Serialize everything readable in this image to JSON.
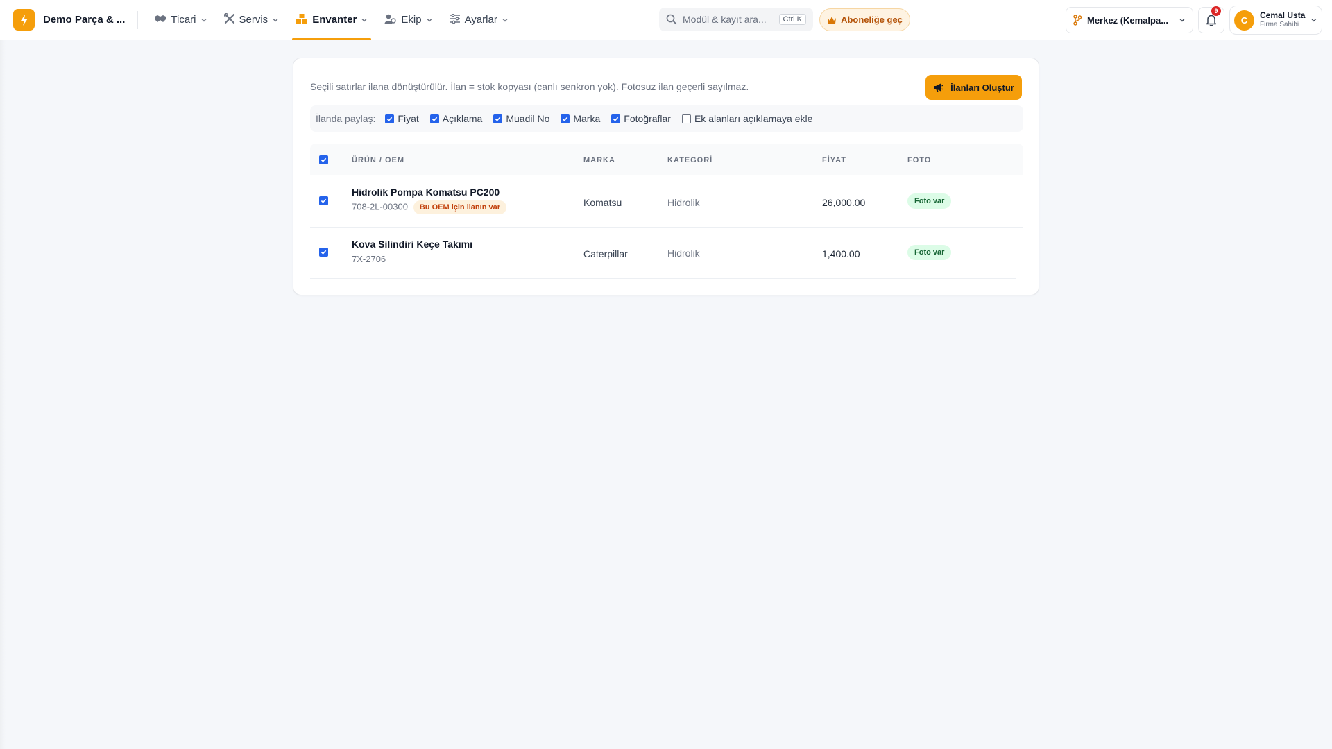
{
  "header": {
    "brand_name": "Demo Parça & ...",
    "nav": [
      {
        "label": "Ticari",
        "icon": "handshake-icon"
      },
      {
        "label": "Servis",
        "icon": "tools-icon"
      },
      {
        "label": "Envanter",
        "icon": "boxes-icon"
      },
      {
        "label": "Ekip",
        "icon": "users-icon"
      },
      {
        "label": "Ayarlar",
        "icon": "sliders-icon"
      }
    ],
    "active_nav": "Envanter",
    "search_placeholder": "Modül & kayıt ara...",
    "search_shortcut": "Ctrl K",
    "subscribe_label": "Aboneliğe geç",
    "branch_label": "Merkez (Kemalpa...",
    "notification_count": "9",
    "user": {
      "initial": "C",
      "name": "Cemal Usta",
      "role": "Firma Sahibi"
    }
  },
  "main": {
    "intro_text": "Seçili satırlar ilana dönüştürülür. İlan = stok kopyası (canlı senkron yok). Fotosuz ilan geçerli sayılmaz.",
    "create_button_label": "İlanları Oluştur",
    "share_label": "İlanda paylaş:",
    "share_options": [
      {
        "label": "Fiyat",
        "checked": true
      },
      {
        "label": "Açıklama",
        "checked": true
      },
      {
        "label": "Muadil No",
        "checked": true
      },
      {
        "label": "Marka",
        "checked": true
      },
      {
        "label": "Fotoğraflar",
        "checked": true
      },
      {
        "label": "Ek alanları açıklamaya ekle",
        "checked": false
      }
    ],
    "columns": [
      "ÜRÜN / OEM",
      "MARKA",
      "KATEGORİ",
      "FİYAT",
      "FOTO"
    ],
    "rows": [
      {
        "name": "Hidrolik Pompa Komatsu PC200",
        "oem": "708-2L-00300",
        "oem_badge": "Bu OEM için ilanın var",
        "brand": "Komatsu",
        "category": "Hidrolik",
        "price": "26,000.00",
        "photo": "Foto var",
        "checked": true
      },
      {
        "name": "Kova Silindiri Keçe Takımı",
        "oem": "7X-2706",
        "oem_badge": "",
        "brand": "Caterpillar",
        "category": "Hidrolik",
        "price": "1,400.00",
        "photo": "Foto var",
        "checked": true
      }
    ]
  },
  "colors": {
    "accent": "#f59e0b",
    "checkbox": "#2563eb",
    "photo_badge_bg": "#dcfce7",
    "oem_badge_bg": "#fdf1dd"
  }
}
